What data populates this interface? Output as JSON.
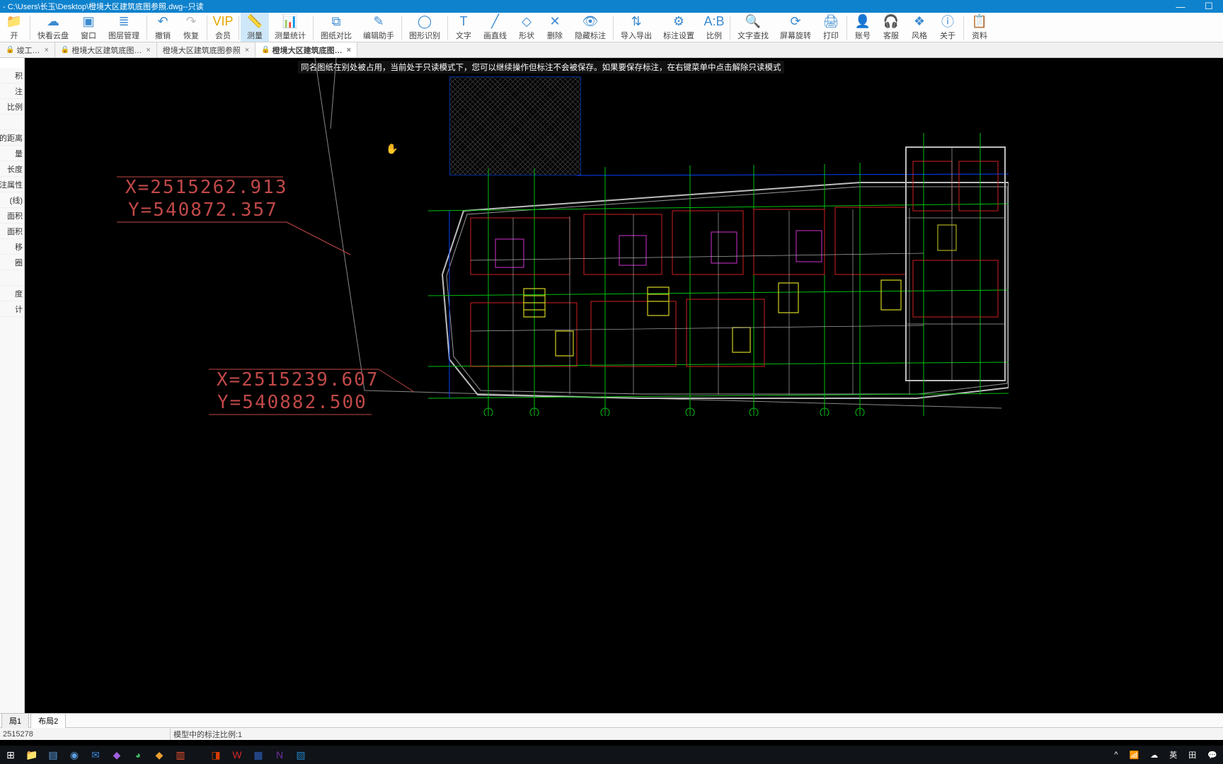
{
  "title": "- C:\\Users\\长玉\\Desktop\\橙境大区建筑底图参照.dwg--只读",
  "toolbar": [
    {
      "name": "open",
      "label": "开",
      "icon": "📁",
      "color": "#3b8bd0"
    },
    {
      "name": "cloud",
      "label": "快看云盘",
      "icon": "☁",
      "color": "#3b8bd0"
    },
    {
      "name": "window",
      "label": "窗口",
      "icon": "▣",
      "color": "#3b8bd0"
    },
    {
      "name": "layer",
      "label": "图层管理",
      "icon": "≣",
      "color": "#3b8bd0"
    },
    {
      "name": "undo",
      "label": "撤销",
      "icon": "↶",
      "color": "#3b8bd0"
    },
    {
      "name": "redo",
      "label": "恢复",
      "icon": "↷",
      "color": "#bbb"
    },
    {
      "name": "vip",
      "label": "会员",
      "icon": "VIP",
      "color": "#e6a700"
    },
    {
      "name": "measure",
      "label": "测量",
      "icon": "📏",
      "color": "#2a7bc0",
      "active": true
    },
    {
      "name": "measure-stat",
      "label": "测量统计",
      "icon": "📊",
      "color": "#3b8bd0"
    },
    {
      "name": "compare",
      "label": "图纸对比",
      "icon": "⧉",
      "color": "#3b8bd0"
    },
    {
      "name": "edit-helper",
      "label": "编辑助手",
      "icon": "✎",
      "color": "#3b8bd0"
    },
    {
      "name": "shape-detect",
      "label": "图形识别",
      "icon": "◯",
      "color": "#3b8bd0"
    },
    {
      "name": "text",
      "label": "文字",
      "icon": "T",
      "color": "#3b8bd0"
    },
    {
      "name": "line",
      "label": "画直线",
      "icon": "╱",
      "color": "#3b8bd0"
    },
    {
      "name": "shape",
      "label": "形状",
      "icon": "◇",
      "color": "#3b8bd0"
    },
    {
      "name": "delete",
      "label": "删除",
      "icon": "✕",
      "color": "#3b8bd0"
    },
    {
      "name": "hide-annot",
      "label": "隐藏标注",
      "icon": "👁",
      "color": "#3b8bd0"
    },
    {
      "name": "import-export",
      "label": "导入导出",
      "icon": "⇅",
      "color": "#3b8bd0"
    },
    {
      "name": "annot-settings",
      "label": "标注设置",
      "icon": "⚙",
      "color": "#3b8bd0"
    },
    {
      "name": "scale",
      "label": "比例",
      "icon": "A:B",
      "color": "#3b8bd0"
    },
    {
      "name": "text-search",
      "label": "文字查找",
      "icon": "🔍",
      "color": "#3b8bd0"
    },
    {
      "name": "screen-rotate",
      "label": "屏幕旋转",
      "icon": "⟳",
      "color": "#3b8bd0"
    },
    {
      "name": "print",
      "label": "打印",
      "icon": "🖨",
      "color": "#3b8bd0"
    },
    {
      "name": "account",
      "label": "账号",
      "icon": "👤",
      "color": "#3b8bd0"
    },
    {
      "name": "support",
      "label": "客服",
      "icon": "🎧",
      "color": "#3b8bd0"
    },
    {
      "name": "style",
      "label": "风格",
      "icon": "❖",
      "color": "#3b8bd0"
    },
    {
      "name": "about",
      "label": "关于",
      "icon": "ⓘ",
      "color": "#3b8bd0"
    },
    {
      "name": "material",
      "label": "资料",
      "icon": "📋",
      "color": "#3b8bd0"
    }
  ],
  "tabs": [
    {
      "label": "竣工…",
      "locked": true,
      "close": true
    },
    {
      "label": "橙境大区建筑底图…",
      "locked": true,
      "close": true
    },
    {
      "label": "橙境大区建筑底图参照",
      "locked": false,
      "close": true
    },
    {
      "label": "橙境大区建筑底图…",
      "locked": true,
      "close": true,
      "active": true
    }
  ],
  "side_items": [
    "积",
    "注",
    "比例",
    "",
    "的距离",
    "量",
    "长度",
    "注属性",
    "(线)",
    "面积",
    "面积",
    "移",
    "圈",
    "",
    "度",
    "计"
  ],
  "notice": "同名图纸在别处被占用，当前处于只读模式下，您可以继续操作但标注不会被保存。如果要保存标注，在右键菜单中点击解除只读模式",
  "coords": {
    "x1": "X=2515262.913",
    "y1": "Y=540872.357",
    "x2": "X=2515239.607",
    "y2": "Y=540882.500"
  },
  "layout_tabs": [
    "局1",
    "布局2"
  ],
  "status": {
    "left": "2515278",
    "right": "模型中的标注比例:1"
  },
  "tray": {
    "ime": "英",
    "grid": "田"
  }
}
